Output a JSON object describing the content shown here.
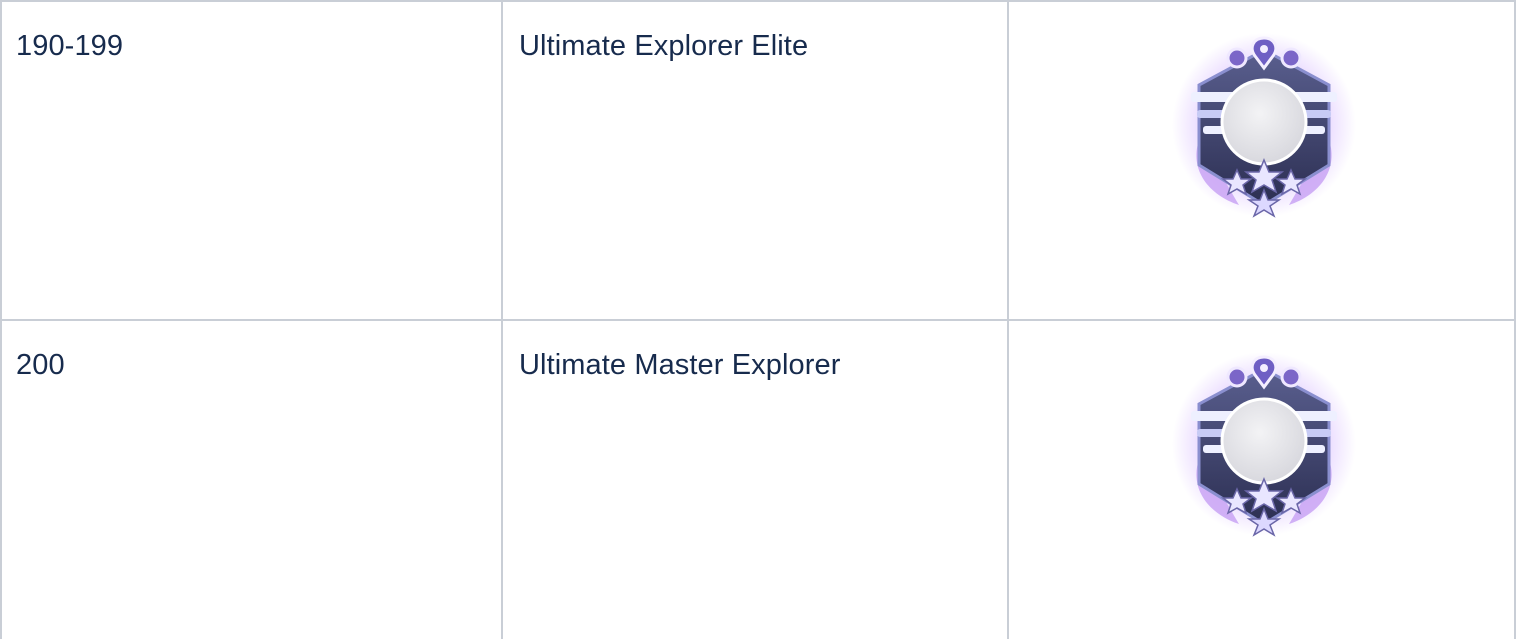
{
  "table": {
    "rows": [
      {
        "level": "190-199",
        "title": "Ultimate Explorer Elite",
        "badge_icon": "explorer-badge-icon"
      },
      {
        "level": "200",
        "title": "Ultimate Master Explorer",
        "badge_icon": "explorer-badge-icon"
      }
    ]
  },
  "colors": {
    "text": "#172b4d",
    "border": "#c9ced6",
    "badge_glow": "#c59bff",
    "badge_metal": "#3b3f66",
    "badge_face": "#e7e7ea"
  }
}
